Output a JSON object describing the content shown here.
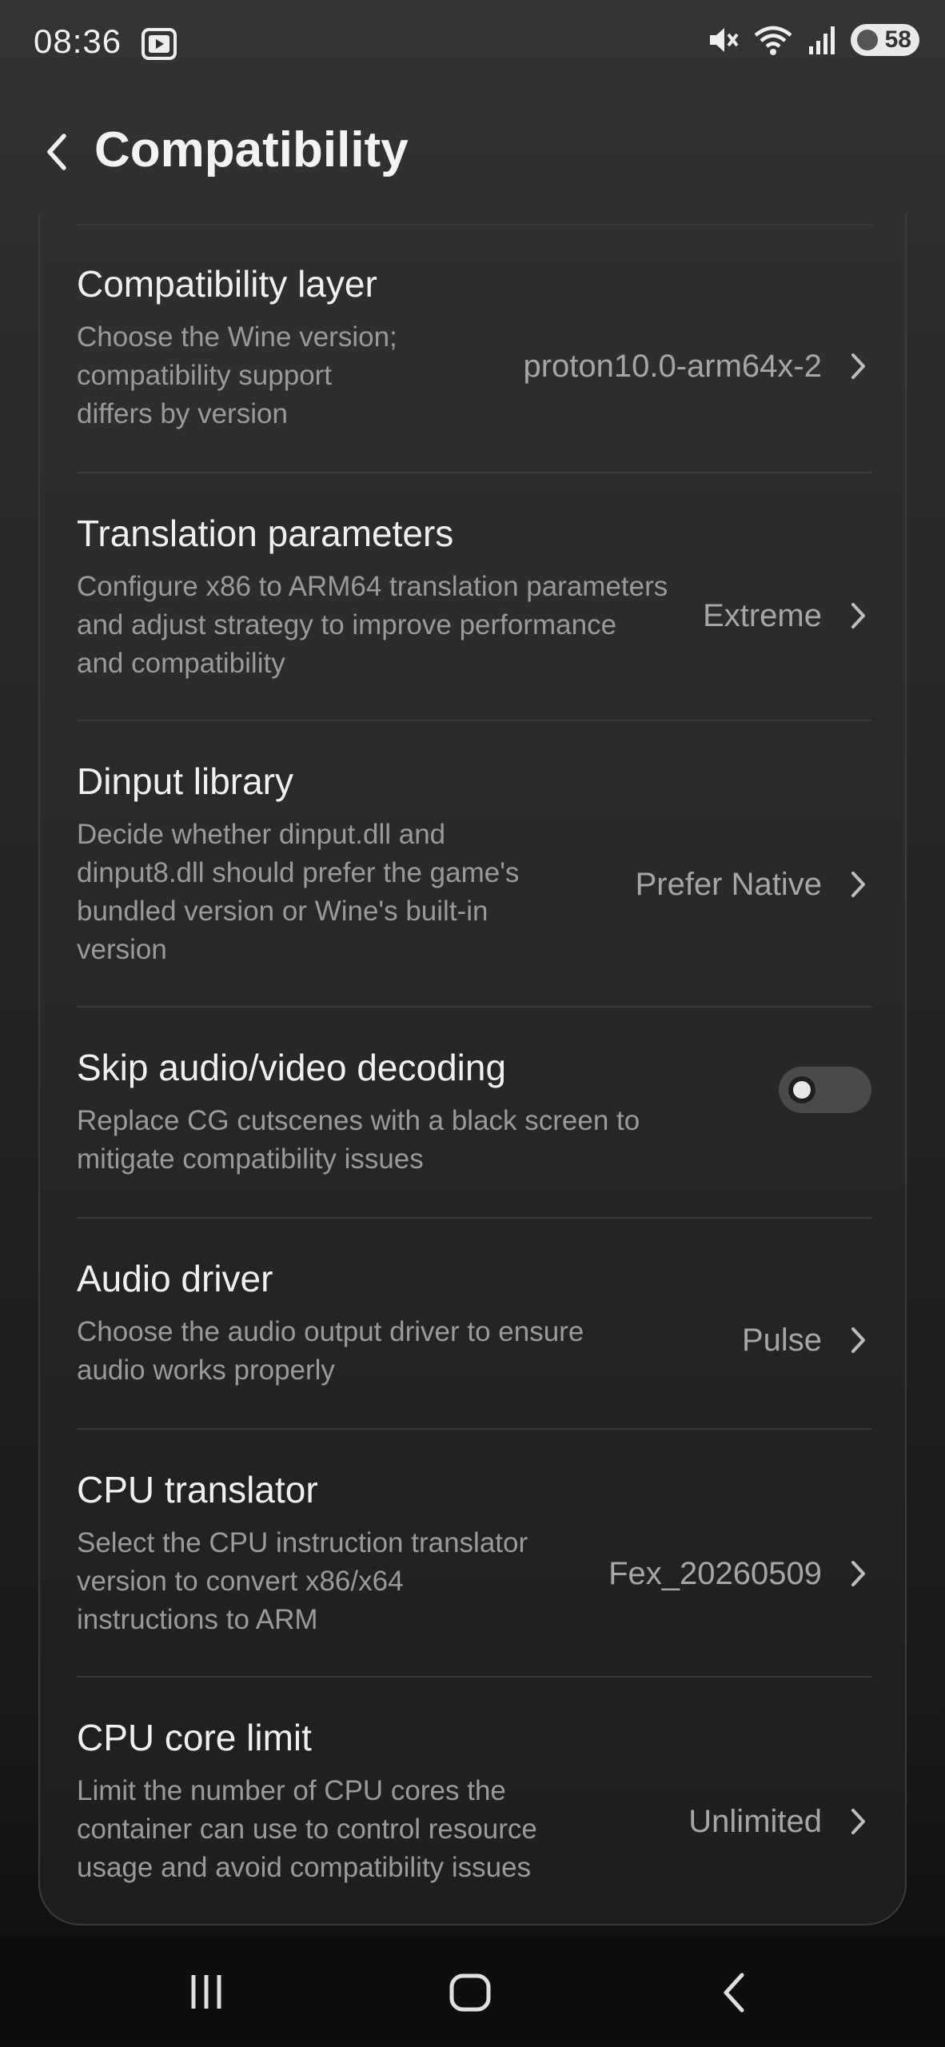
{
  "status_bar": {
    "time": "08:36",
    "battery": "58",
    "icons": [
      "youtube-icon",
      "mute-icon",
      "wifi-icon",
      "signal-icon",
      "battery-icon"
    ]
  },
  "header": {
    "title": "Compatibility"
  },
  "settings": [
    {
      "title": "Compatibility layer",
      "description": "Choose the Wine version; compatibility support differs by version",
      "value": "proton10.0-arm64x-2"
    },
    {
      "title": "Translation parameters",
      "description": "Configure x86 to ARM64 translation parameters and adjust strategy to improve performance and compatibility",
      "value": "Extreme"
    },
    {
      "title": "Dinput library",
      "description": "Decide whether dinput.dll and dinput8.dll should prefer the game's bundled version or Wine's built-in version",
      "value": "Prefer Native"
    },
    {
      "title": "Skip audio/video decoding",
      "description": "Replace CG cutscenes with a black screen to mitigate compatibility issues",
      "toggle_on": false
    },
    {
      "title": "Audio driver",
      "description": "Choose the audio output driver to ensure audio works properly",
      "value": "Pulse"
    },
    {
      "title": "CPU translator",
      "description": "Select the CPU instruction translator version to convert x86/x64 instructions to ARM",
      "value": "Fex_20260509"
    },
    {
      "title": "CPU core limit",
      "description": "Limit the number of CPU cores the container can use to control resource usage and avoid compatibility issues",
      "value": "Unlimited"
    }
  ],
  "nav_bar": {
    "icons": [
      "recents-icon",
      "home-icon",
      "back-icon"
    ]
  },
  "colors": {
    "background_top": "#343434",
    "background_bottom": "#111112",
    "title_text": "#f0f0f0",
    "secondary_text": "#9a9a9a",
    "value_text": "#a6a6a6"
  }
}
